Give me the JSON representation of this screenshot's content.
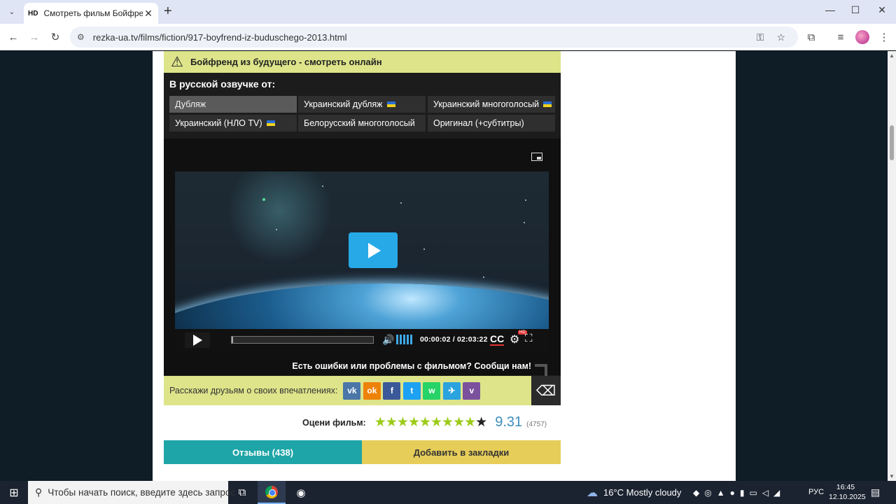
{
  "browser": {
    "tab_favicon": "HD",
    "tab_title": "Смотреть фильм Бойфренд из будущего",
    "tab_close": "✕",
    "new_tab": "+",
    "url": "rezka-ua.tv/films/fiction/917-boyfrend-iz-buduschego-2013.html",
    "window_controls": {
      "minimize": "—",
      "maximize": "☐",
      "close": "✕"
    }
  },
  "page": {
    "warning_title": "Бойфренд из будущего - смотреть онлайн",
    "voice_heading": "В русской озвучке от:",
    "voices": [
      {
        "label": "Дубляж",
        "flag": false,
        "active": true
      },
      {
        "label": "Украинский дубляж",
        "flag": true,
        "active": false
      },
      {
        "label": "Украинский многоголосый",
        "flag": true,
        "active": false
      },
      {
        "label": "Украинский (НЛО TV)",
        "flag": true,
        "active": false
      },
      {
        "label": "Белорусский многоголосый",
        "flag": false,
        "active": false
      },
      {
        "label": "Оригинал (+субтитры)",
        "flag": false,
        "active": false
      }
    ],
    "player": {
      "time": "00:00:02 / 02:03:22",
      "progress": 0.01,
      "volume_bars": 5,
      "cc_label": "CC",
      "hd_badge": "HD"
    },
    "report_text": "Есть ошибки или проблемы с фильмом? Сообщи нам!",
    "share_text": "Расскажи друзьям о своих впечатлениях:",
    "share_buttons": [
      {
        "name": "vk",
        "glyph": "vk",
        "color": "#4a76a8"
      },
      {
        "name": "odnoklassniki",
        "glyph": "ok",
        "color": "#ee8208"
      },
      {
        "name": "facebook",
        "glyph": "f",
        "color": "#3b5998"
      },
      {
        "name": "twitter",
        "glyph": "t",
        "color": "#1da1f2"
      },
      {
        "name": "whatsapp",
        "glyph": "w",
        "color": "#25d366"
      },
      {
        "name": "telegram",
        "glyph": "✈",
        "color": "#2aa3df"
      },
      {
        "name": "viber",
        "glyph": "v",
        "color": "#7b519d"
      }
    ],
    "rating": {
      "label": "Оцени фильм:",
      "score": "9.31",
      "votes": "(4757)",
      "stars_total": 10,
      "stars_filled": 9
    },
    "reviews_button": "Отзывы (438)",
    "bookmark_button": "Добавить в закладки"
  },
  "taskbar": {
    "search_placeholder": "Чтобы начать поиск, введите здесь запрос",
    "weather": "16°C  Mostly cloudy",
    "language": "РУС",
    "time": "16:45",
    "date": "12.10.2025"
  }
}
